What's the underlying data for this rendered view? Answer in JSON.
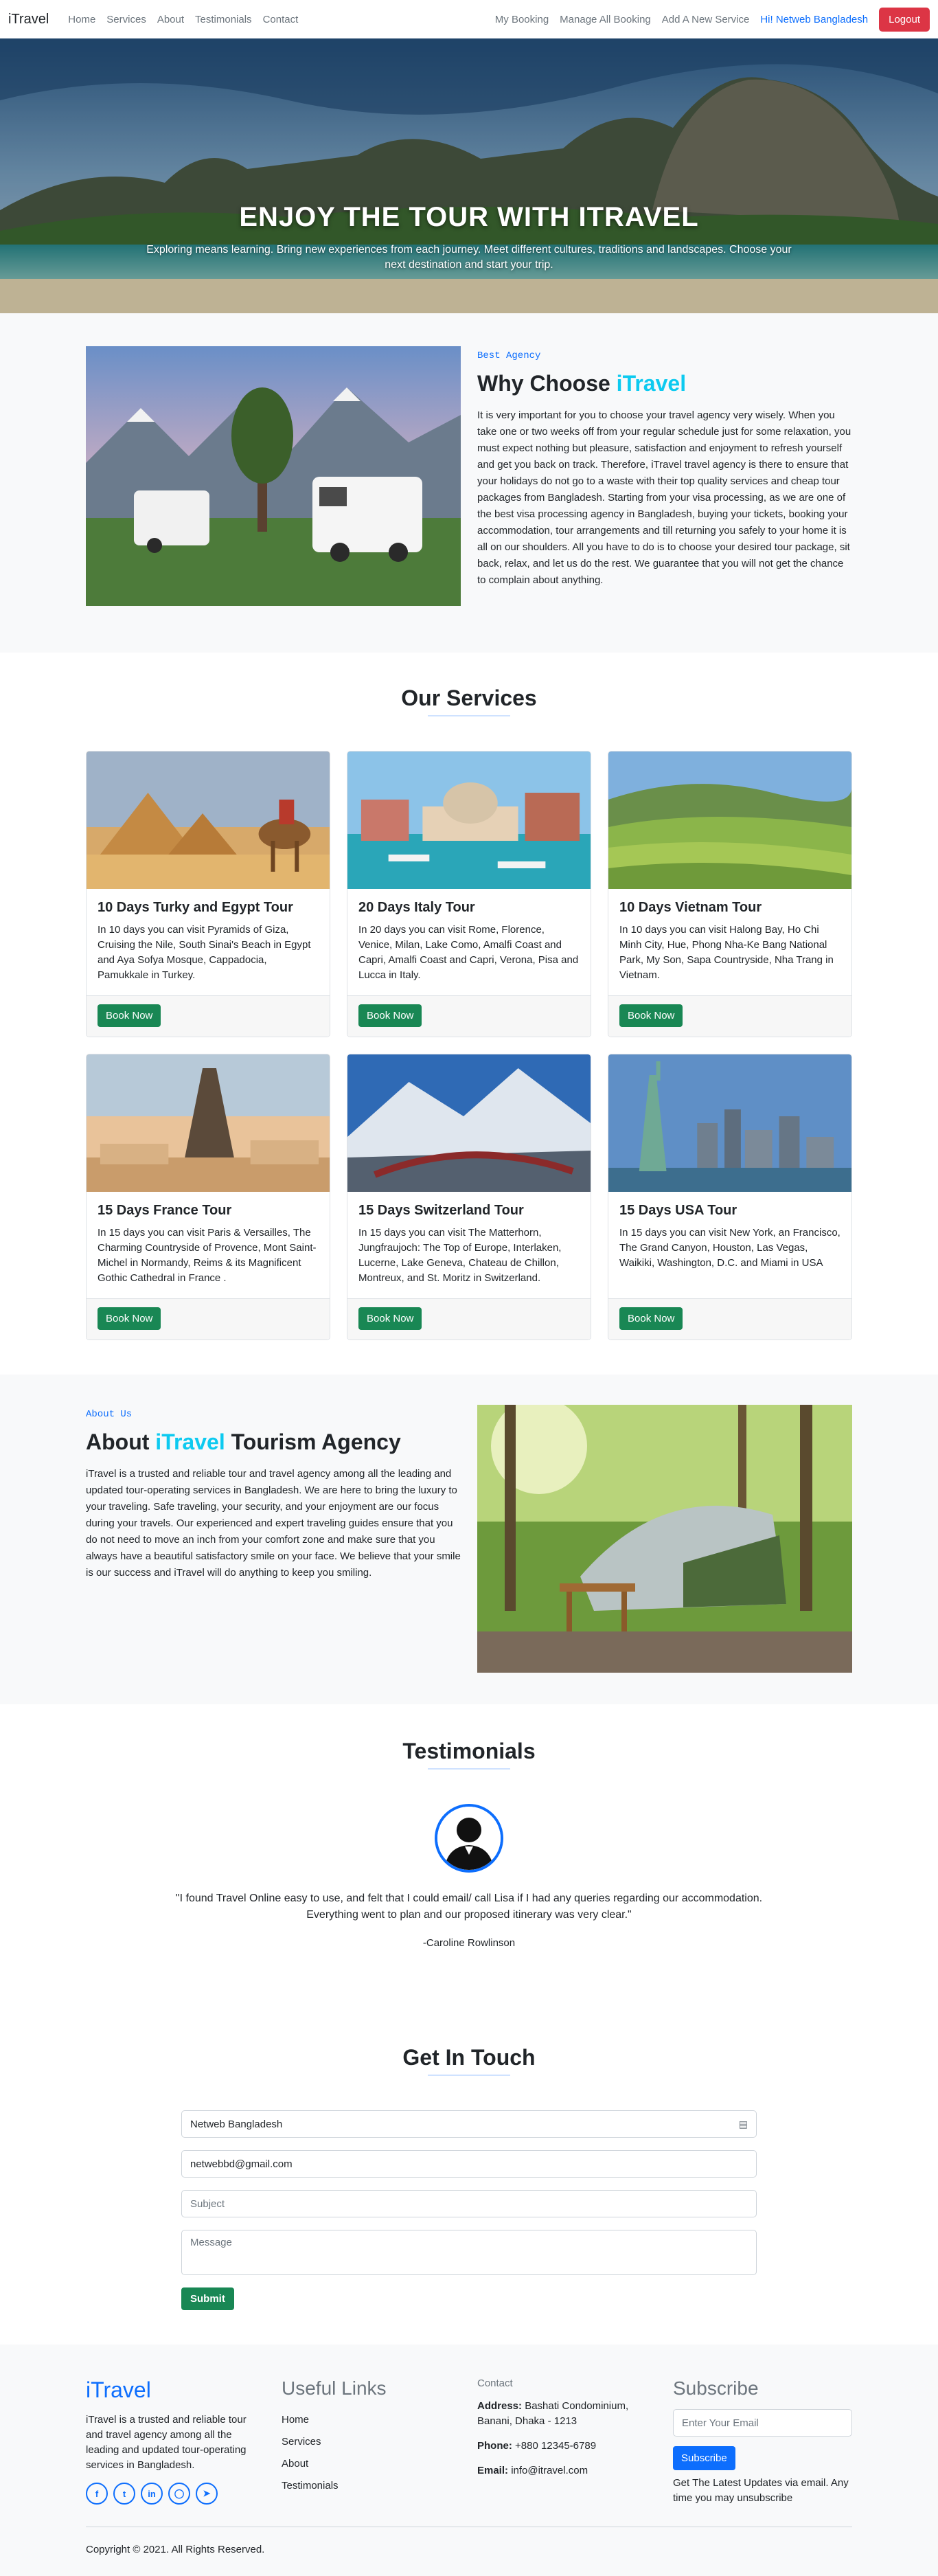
{
  "nav": {
    "brand": "iTravel",
    "left": [
      "Home",
      "Services",
      "About",
      "Testimonials",
      "Contact"
    ],
    "right": [
      "My Booking",
      "Manage All Booking",
      "Add A New Service"
    ],
    "greeting": "Hi! Netweb Bangladesh",
    "logout": "Logout"
  },
  "hero": {
    "title": "ENJOY THE TOUR WITH ITRAVEL",
    "subtitle": "Exploring means learning. Bring new experiences from each journey. Meet different cultures, traditions and landscapes. Choose your next destination and start your trip."
  },
  "why": {
    "kicker": "Best Agency",
    "title_prefix": "Why Choose",
    "title_accent": "iTravel",
    "text": "It is very important for you to choose your travel agency very wisely. When you take one or two weeks off from your regular schedule just for some relaxation, you must expect nothing but pleasure, satisfaction and enjoyment to refresh yourself and get you back on track. Therefore, iTravel travel agency is there to ensure that your holidays do not go to a waste with their top quality services and cheap tour packages from Bangladesh. Starting from your visa processing, as we are one of the best visa processing agency in Bangladesh, buying your tickets, booking your accommodation, tour arrangements and till returning you safely to your home it is all on our shoulders. All you have to do is to choose your desired tour package, sit back, relax, and let us do the rest. We guarantee that you will not get the chance to complain about anything."
  },
  "services": {
    "title": "Our Services",
    "button": "Book Now",
    "items": [
      {
        "title": "10 Days Turky and Egypt Tour",
        "text": "In 10 days you can visit Pyramids of Giza, Cruising the Nile, South Sinai's Beach in Egypt and Aya Sofya Mosque, Cappadocia, Pamukkale in Turkey."
      },
      {
        "title": "20 Days Italy Tour",
        "text": "In 20 days you can visit Rome, Florence, Venice, Milan, Lake Como, Amalfi Coast and Capri, Amalfi Coast and Capri, Verona, Pisa and Lucca in Italy."
      },
      {
        "title": "10 Days Vietnam Tour",
        "text": "In 10 days you can visit Halong Bay, Ho Chi Minh City, Hue, Phong Nha-Ke Bang National Park, My Son, Sapa Countryside, Nha Trang in Vietnam."
      },
      {
        "title": "15 Days France Tour",
        "text": "In 15 days you can visit Paris & Versailles, The Charming Countryside of Provence, Mont Saint-Michel in Normandy, Reims & its Magnificent Gothic Cathedral in France ."
      },
      {
        "title": "15 Days Switzerland Tour",
        "text": "In 15 days you can visit The Matterhorn, Jungfraujoch: The Top of Europe, Interlaken, Lucerne, Lake Geneva, Chateau de Chillon, Montreux, and St. Moritz in Switzerland."
      },
      {
        "title": "15 Days USA Tour",
        "text": "In 15 days you can visit New York, an Francisco, The Grand Canyon, Houston, Las Vegas, Waikiki, Washington, D.C. and Miami in USA"
      }
    ]
  },
  "about": {
    "kicker": "About Us",
    "title_prefix": "About",
    "title_accent": "iTravel",
    "title_suffix": "Tourism Agency",
    "text": "iTravel is a trusted and reliable tour and travel agency among all the leading and updated tour-operating services in Bangladesh. We are here to bring the luxury to your traveling. Safe traveling, your security, and your enjoyment are our focus during your travels. Our experienced and expert traveling guides ensure that you do not need to move an inch from your comfort zone and make sure that you always have a beautiful satisfactory smile on your face. We believe that your smile is our success and iTravel will do anything to keep you smiling."
  },
  "testimonials": {
    "title": "Testimonials",
    "quote": "\"I found Travel Online easy to use, and felt that I could email/ call Lisa if I had any queries regarding our accommodation. Everything went to plan and our proposed itinerary was very clear.\"",
    "author": "-Caroline Rowlinson"
  },
  "contact": {
    "title": "Get In Touch",
    "name_value": "Netweb Bangladesh",
    "email_value": "netwebbd@gmail.com",
    "subject_placeholder": "Subject",
    "message_placeholder": "Message",
    "submit": "Submit"
  },
  "footer": {
    "brand": "iTravel",
    "about": "iTravel is a trusted and reliable tour and travel agency among all the leading and updated tour-operating services in Bangladesh.",
    "links_title": "Useful Links",
    "links": [
      "Home",
      "Services",
      "About",
      "Testimonials"
    ],
    "contact_title": "Contact",
    "address_label": "Address:",
    "address": "Bashati Condominium, Banani, Dhaka - 1213",
    "phone_label": "Phone:",
    "phone": "+880 12345-6789",
    "email_label": "Email:",
    "email": "info@itravel.com",
    "subscribe_title": "Subscribe",
    "subscribe_placeholder": "Enter Your Email",
    "subscribe_button": "Subscribe",
    "subscribe_note": "Get The Latest Updates via email. Any time you may unsubscribe",
    "copyright": "Copyright © 2021. All Rights Reserved.",
    "socials": [
      "facebook-icon",
      "twitter-icon",
      "linkedin-icon",
      "instagram-icon",
      "telegram-icon"
    ]
  },
  "colors": {
    "primary": "#0d6efd",
    "accent": "#0dcaf0",
    "success": "#198754",
    "danger": "#dc3545"
  }
}
